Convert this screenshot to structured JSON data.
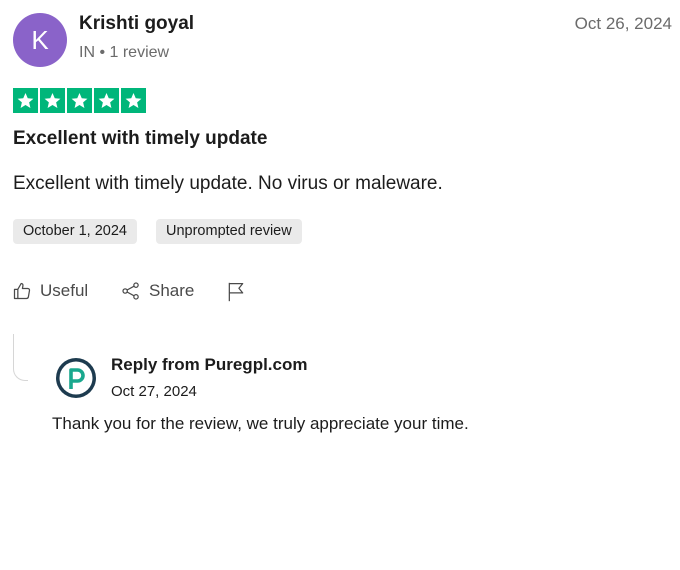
{
  "reviewer": {
    "initial": "K",
    "name": "Krishti goyal",
    "meta": "IN • 1 review",
    "avatar_color": "#8a63c9"
  },
  "review": {
    "posted_date": "Oct 26, 2024",
    "rating": 5,
    "max_rating": 5,
    "star_color": "#00b67a",
    "title": "Excellent with timely update",
    "body": "Excellent with timely update. No virus or maleware.",
    "tags": {
      "experience_date": "October 1, 2024",
      "review_type": "Unprompted review"
    }
  },
  "actions": {
    "useful_label": "Useful",
    "share_label": "Share",
    "useful_icon": "thumbs-up-icon",
    "share_icon": "share-icon",
    "flag_icon": "flag-icon"
  },
  "reply": {
    "title": "Reply from Puregpl.com",
    "date": "Oct 27, 2024",
    "body": "Thank you for the review, we truly appreciate your time.",
    "logo_icon": "puregpl-logo-icon",
    "logo_color": "#1d3b4f",
    "logo_accent": "#1aa88e"
  }
}
